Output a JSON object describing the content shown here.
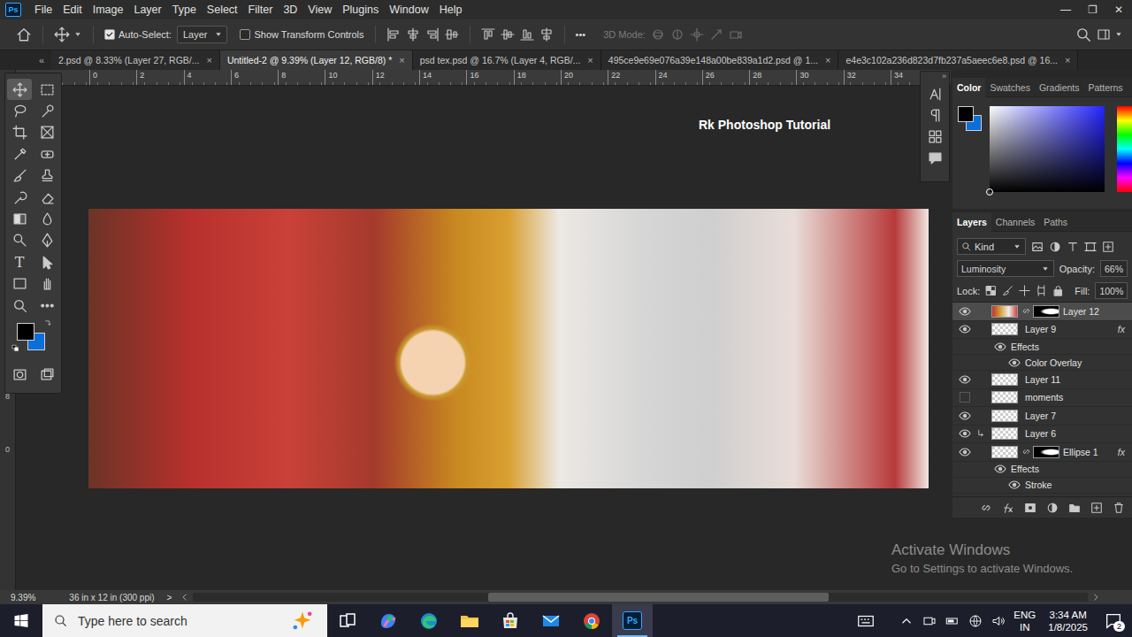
{
  "app": {
    "logo": "Ps"
  },
  "menu": [
    "File",
    "Edit",
    "Image",
    "Layer",
    "Type",
    "Select",
    "Filter",
    "3D",
    "View",
    "Plugins",
    "Window",
    "Help"
  ],
  "window_controls": [
    "—",
    "❐",
    "✕"
  ],
  "options_bar": {
    "auto_select": {
      "label": "Auto-Select:",
      "checked": true
    },
    "target": "Layer",
    "show_transform": {
      "label": "Show Transform Controls",
      "checked": false
    },
    "more": "•••",
    "mode_3d": {
      "label": "3D Mode:",
      "disabled": true
    }
  },
  "collapse": {
    "toolbar": "«",
    "panels": "»"
  },
  "tabs": [
    {
      "label": "2.psd @ 8.33% (Layer 27, RGB/...",
      "selected": false,
      "close": "×"
    },
    {
      "label": "Untitled-2 @ 9.39% (Layer 12, RGB/8) *",
      "selected": true,
      "close": "×"
    },
    {
      "label": "psd tex.psd @ 16.7% (Layer 4, RGB/...",
      "selected": false,
      "close": "×"
    },
    {
      "label": "495ce9e69e076a39e148a00be839a1d2.psd @ 1...",
      "selected": false,
      "close": "×"
    },
    {
      "label": "e4e3c102a236d823d7fb237a5aeec6e8.psd @ 16...",
      "selected": false,
      "close": "×"
    }
  ],
  "rulers": {
    "horizontal": [
      "0",
      "2",
      "4",
      "6",
      "8",
      "10",
      "12",
      "14",
      "16",
      "18",
      "20",
      "22",
      "24",
      "26",
      "28",
      "30",
      "32",
      "34"
    ],
    "vertical": [
      "8",
      "0"
    ]
  },
  "toolbar": {
    "tools": [
      {
        "kind": "move",
        "selected": true
      },
      {
        "kind": "marquee",
        "selected": false
      },
      {
        "kind": "lasso",
        "selected": false
      },
      {
        "kind": "quick",
        "selected": false
      },
      {
        "kind": "crop",
        "selected": false
      },
      {
        "kind": "frame",
        "selected": false
      },
      {
        "kind": "eyedropper",
        "selected": false
      },
      {
        "kind": "heal",
        "selected": false
      },
      {
        "kind": "brush",
        "selected": false
      },
      {
        "kind": "stamp",
        "selected": false
      },
      {
        "kind": "history",
        "selected": false
      },
      {
        "kind": "eraser",
        "selected": false
      },
      {
        "kind": "gradient",
        "selected": false
      },
      {
        "kind": "blur",
        "selected": false
      },
      {
        "kind": "dodge",
        "selected": false
      },
      {
        "kind": "pen",
        "selected": false
      },
      {
        "kind": "type",
        "selected": false,
        "glyph": "T"
      },
      {
        "kind": "pathsel",
        "selected": false
      },
      {
        "kind": "rect",
        "selected": false
      },
      {
        "kind": "hand",
        "selected": false
      },
      {
        "kind": "zoom",
        "selected": false
      },
      {
        "kind": "more",
        "selected": false
      },
      {
        "kind": "quickmask",
        "selected": false
      },
      {
        "kind": "screenmode",
        "selected": false
      }
    ],
    "colors": [
      {
        "kind": "foreground",
        "color": "#000000"
      },
      {
        "kind": "background",
        "color": "#0a6fd8"
      }
    ]
  },
  "watermark": "Rk Photoshop Tutorial",
  "color_panel": {
    "tabs": [
      {
        "label": "Color",
        "selected": true
      },
      {
        "label": "Swatches",
        "selected": false
      },
      {
        "label": "Gradients",
        "selected": false
      },
      {
        "label": "Patterns",
        "selected": false
      }
    ],
    "swatches": [
      {
        "kind": "foreground",
        "color": "#000000"
      },
      {
        "kind": "background",
        "color": "#0a6fd8"
      },
      {
        "kind": "field",
        "color": "#2424ff"
      }
    ]
  },
  "layers_panel": {
    "tabs": [
      {
        "label": "Layers",
        "selected": true
      },
      {
        "label": "Channels",
        "selected": false
      },
      {
        "label": "Paths",
        "selected": false
      }
    ],
    "filter": "Kind",
    "blend_mode": "Luminosity",
    "opacity": {
      "label": "Opacity:",
      "value": "66%"
    },
    "lock_label": "Lock:",
    "fill": {
      "label": "Fill:",
      "value": "100%"
    },
    "layers": [
      {
        "kind": "layer",
        "name": "Layer 12",
        "visible": true,
        "selected": true,
        "mask": true,
        "clipped": false
      },
      {
        "kind": "layer",
        "name": "Layer 9",
        "visible": true,
        "selected": false,
        "mask": false,
        "clipped": false,
        "fx": "fx"
      },
      {
        "kind": "effects",
        "name": "Effects",
        "visible": true
      },
      {
        "kind": "effect",
        "name": "Color Overlay",
        "visible": true
      },
      {
        "kind": "layer",
        "name": "Layer 11",
        "visible": true,
        "selected": false,
        "mask": false,
        "clipped": false
      },
      {
        "kind": "layer",
        "name": "moments",
        "visible": false,
        "selected": false,
        "mask": false,
        "clipped": false
      },
      {
        "kind": "layer",
        "name": "Layer 7",
        "visible": true,
        "selected": false,
        "mask": false,
        "clipped": false
      },
      {
        "kind": "layer",
        "name": "Layer 6",
        "visible": true,
        "selected": false,
        "mask": false,
        "clipped": true
      },
      {
        "kind": "layer",
        "name": "Ellipse 1",
        "visible": true,
        "selected": false,
        "mask": true,
        "clipped": false,
        "fx": "fx"
      },
      {
        "kind": "effects",
        "name": "Effects",
        "visible": true
      },
      {
        "kind": "effect",
        "name": "Stroke",
        "visible": true
      }
    ]
  },
  "status_bar": {
    "zoom": "9.39%",
    "document": "36 in x 12 in (300 ppi)",
    "arrow": ">",
    "scroll": {
      "level": 0.38
    }
  },
  "activation": {
    "title": "Activate Windows",
    "subtitle": "Go to Settings to activate Windows."
  },
  "taskbar": {
    "search_placeholder": "Type here to search",
    "apps": [
      {
        "kind": "taskview",
        "selected": false
      },
      {
        "kind": "copilot",
        "selected": false
      },
      {
        "kind": "edge",
        "selected": false
      },
      {
        "kind": "explorer",
        "selected": false
      },
      {
        "kind": "store",
        "selected": false
      },
      {
        "kind": "mail",
        "selected": false
      },
      {
        "kind": "chrome",
        "selected": false
      },
      {
        "kind": "photoshop",
        "selected": true,
        "label": "Ps"
      }
    ],
    "language": [
      "ENG",
      "IN"
    ],
    "time": "3:34 AM",
    "date": "1/8/2025",
    "notifications": "2"
  }
}
